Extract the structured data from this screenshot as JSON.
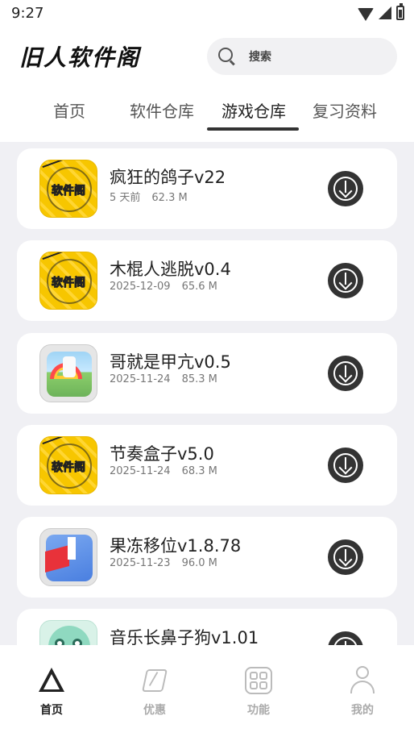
{
  "status_bar": {
    "time": "9:27"
  },
  "header": {
    "logo_text": "旧人软件阁"
  },
  "search": {
    "placeholder": "搜索"
  },
  "tabs": [
    {
      "label": "首页",
      "active": false
    },
    {
      "label": "软件仓库",
      "active": false
    },
    {
      "label": "游戏仓库",
      "active": true
    },
    {
      "label": "复习资料",
      "active": false
    }
  ],
  "apps": [
    {
      "title": "疯狂的鸽子v22",
      "date": "5 天前",
      "size": "62.3 M",
      "icon": "software-pavilion-icon",
      "icon_brand": "软件阁"
    },
    {
      "title": "木棍人逃脱v0.4",
      "date": "2025-12-09",
      "size": "65.6 M",
      "icon": "software-pavilion-icon",
      "icon_brand": "软件阁"
    },
    {
      "title": "哥就是甲亢v0.5",
      "date": "2025-11-24",
      "size": "85.3 M",
      "icon": "rainbow-game-icon"
    },
    {
      "title": "节奏盒子v5.0",
      "date": "2025-11-24",
      "size": "68.3 M",
      "icon": "software-pavilion-icon",
      "icon_brand": "软件阁"
    },
    {
      "title": "果冻移位v1.8.78",
      "date": "2025-11-23",
      "size": "96.0 M",
      "icon": "jelly-shift-icon"
    },
    {
      "title": "音乐长鼻子狗v1.01",
      "date": "",
      "size": "",
      "icon": "green-dog-icon"
    }
  ],
  "bottom_nav": [
    {
      "label": "首页",
      "icon": "home-triangle-icon",
      "active": true
    },
    {
      "label": "优惠",
      "icon": "lightning-icon",
      "active": false
    },
    {
      "label": "功能",
      "icon": "features-grid-icon",
      "active": false
    },
    {
      "label": "我的",
      "icon": "profile-icon",
      "active": false
    }
  ],
  "colors": {
    "accent": "#333333",
    "list_background": "#f0f0f4",
    "icon_yellow": "#f7c600"
  }
}
